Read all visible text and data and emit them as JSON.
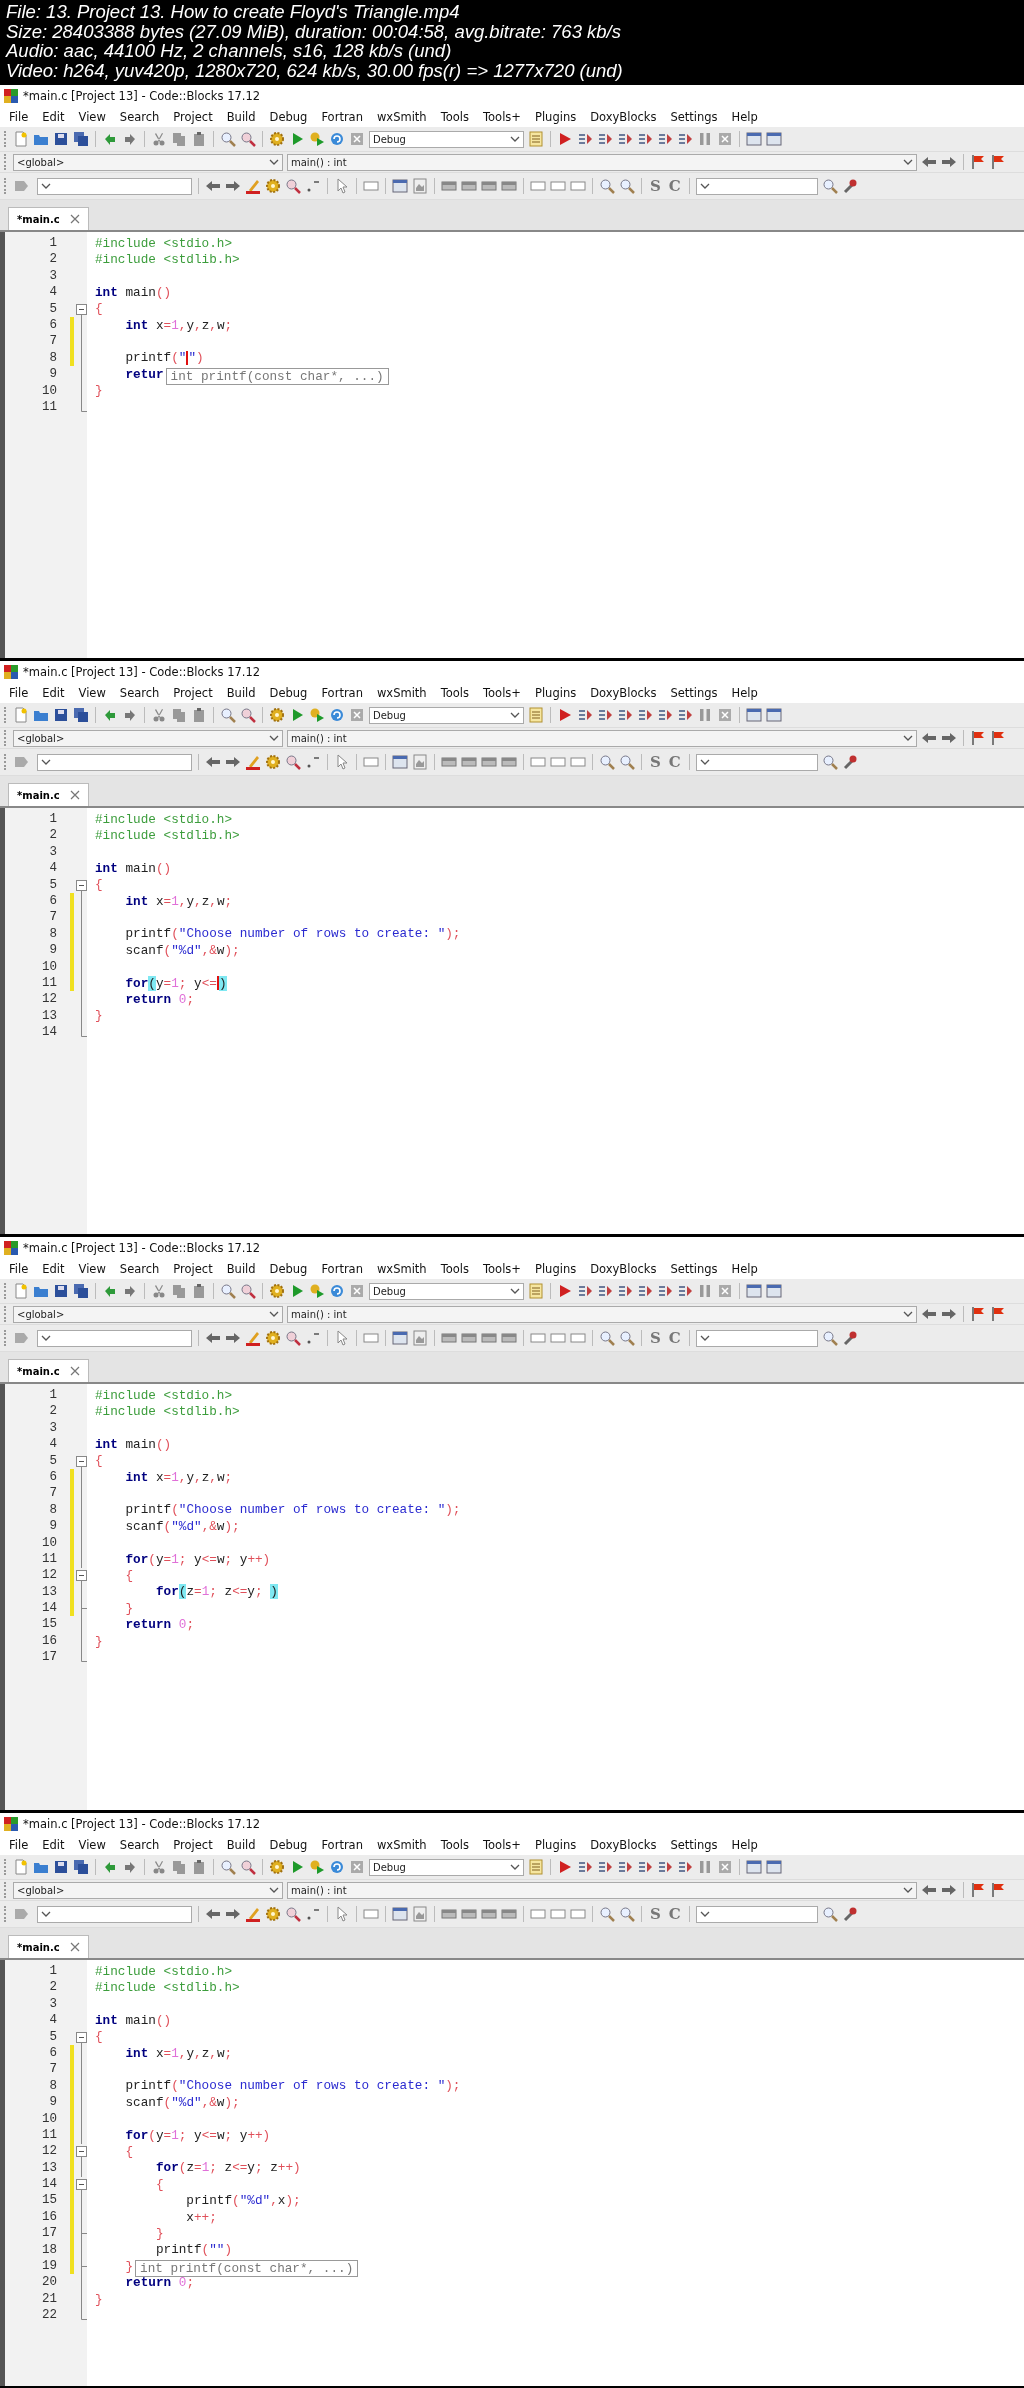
{
  "header": [
    "File: 13. Project 13. How to create Floyd's Triangle.mp4",
    "Size: 28403388 bytes (27.09 MiB), duration: 00:04:58, avg.bitrate: 763 kb/s",
    "Audio: aac, 44100 Hz, 2 channels, s16, 128 kb/s (und)",
    "Video: h264, yuv420p, 1280x720, 624 kb/s, 30.00 fps(r) => 1277x720 (und)"
  ],
  "frames": [
    {
      "window_title": "*main.c [Project 13] - Code::Blocks 17.12",
      "menu": [
        "File",
        "Edit",
        "View",
        "Search",
        "Project",
        "Build",
        "Debug",
        "Fortran",
        "wxSmith",
        "Tools",
        "Tools+",
        "Plugins",
        "DoxyBlocks",
        "Settings",
        "Help"
      ],
      "build_target": "Debug",
      "scope": "<global>",
      "function": "main() : int",
      "toolbar_letters": [
        "S",
        "C"
      ],
      "tab": {
        "label": "*main.c",
        "selected": true
      },
      "code": [
        {
          "number": "1",
          "changed": false,
          "kind": "plain",
          "tokens": [
            {
              "kind": "pp",
              "text": "#include <stdio.h>"
            }
          ]
        },
        {
          "number": "2",
          "changed": false,
          "kind": "plain",
          "tokens": [
            {
              "kind": "pp",
              "text": "#include <stdlib.h>"
            }
          ]
        },
        {
          "number": "3",
          "changed": false,
          "kind": "plain"
        },
        {
          "number": "4",
          "changed": false,
          "kind": "plain",
          "tokens": [
            {
              "kind": "kw",
              "text": "int"
            },
            {
              "kind": "txt",
              "text": " main"
            },
            {
              "kind": "op",
              "text": "()"
            }
          ]
        },
        {
          "number": "5",
          "changed": false,
          "kind": "fold_start",
          "tokens": [
            {
              "kind": "op",
              "text": "{"
            }
          ]
        },
        {
          "number": "6",
          "changed": true,
          "kind": "fold_body",
          "tokens": [
            {
              "kind": "kw",
              "text": "    int"
            },
            {
              "kind": "txt",
              "text": " x"
            },
            {
              "kind": "op",
              "text": "="
            },
            {
              "kind": "num",
              "text": "1"
            },
            {
              "kind": "op",
              "text": ","
            },
            {
              "kind": "txt",
              "text": "y"
            },
            {
              "kind": "op",
              "text": ","
            },
            {
              "kind": "txt",
              "text": "z"
            },
            {
              "kind": "op",
              "text": ","
            },
            {
              "kind": "txt",
              "text": "w"
            },
            {
              "kind": "op",
              "text": ";"
            }
          ]
        },
        {
          "number": "7",
          "changed": true,
          "kind": "fold_body"
        },
        {
          "number": "8",
          "changed": true,
          "kind": "fold_body",
          "tokens": [
            {
              "kind": "txt",
              "text": "    printf"
            },
            {
              "kind": "op",
              "text": "("
            },
            {
              "kind": "str",
              "text": "\""
            },
            {
              "kind": "caret"
            },
            {
              "kind": "str",
              "text": "\""
            },
            {
              "kind": "op",
              "text": ")"
            }
          ]
        },
        {
          "number": "9",
          "changed": false,
          "kind": "fold_body",
          "tokens": [
            {
              "kind": "kw",
              "text": "    retur"
            }
          ],
          "calltip": "int printf(const char*, ...)"
        },
        {
          "number": "10",
          "changed": false,
          "kind": "fold_body",
          "tokens": [
            {
              "kind": "op",
              "text": "}"
            }
          ]
        },
        {
          "number": "11",
          "changed": false,
          "kind": "fold_end"
        }
      ]
    },
    {
      "window_title": "*main.c [Project 13] - Code::Blocks 17.12",
      "menu": [
        "File",
        "Edit",
        "View",
        "Search",
        "Project",
        "Build",
        "Debug",
        "Fortran",
        "wxSmith",
        "Tools",
        "Tools+",
        "Plugins",
        "DoxyBlocks",
        "Settings",
        "Help"
      ],
      "build_target": "Debug",
      "scope": "<global>",
      "function": "main() : int",
      "toolbar_letters": [
        "S",
        "C"
      ],
      "tab": {
        "label": "*main.c",
        "selected": true
      },
      "code": [
        {
          "number": "1",
          "changed": false,
          "kind": "plain",
          "tokens": [
            {
              "kind": "pp",
              "text": "#include <stdio.h>"
            }
          ]
        },
        {
          "number": "2",
          "changed": false,
          "kind": "plain",
          "tokens": [
            {
              "kind": "pp",
              "text": "#include <stdlib.h>"
            }
          ]
        },
        {
          "number": "3",
          "changed": false,
          "kind": "plain"
        },
        {
          "number": "4",
          "changed": false,
          "kind": "plain",
          "tokens": [
            {
              "kind": "kw",
              "text": "int"
            },
            {
              "kind": "txt",
              "text": " main"
            },
            {
              "kind": "op",
              "text": "()"
            }
          ]
        },
        {
          "number": "5",
          "changed": false,
          "kind": "fold_start",
          "tokens": [
            {
              "kind": "op",
              "text": "{"
            }
          ]
        },
        {
          "number": "6",
          "changed": true,
          "kind": "fold_body",
          "tokens": [
            {
              "kind": "kw",
              "text": "    int"
            },
            {
              "kind": "txt",
              "text": " x"
            },
            {
              "kind": "op",
              "text": "="
            },
            {
              "kind": "num",
              "text": "1"
            },
            {
              "kind": "op",
              "text": ","
            },
            {
              "kind": "txt",
              "text": "y"
            },
            {
              "kind": "op",
              "text": ","
            },
            {
              "kind": "txt",
              "text": "z"
            },
            {
              "kind": "op",
              "text": ","
            },
            {
              "kind": "txt",
              "text": "w"
            },
            {
              "kind": "op",
              "text": ";"
            }
          ]
        },
        {
          "number": "7",
          "changed": true,
          "kind": "fold_body"
        },
        {
          "number": "8",
          "changed": true,
          "kind": "fold_body",
          "tokens": [
            {
              "kind": "txt",
              "text": "    printf"
            },
            {
              "kind": "op",
              "text": "("
            },
            {
              "kind": "str",
              "text": "\"Choose number of rows to create: \""
            },
            {
              "kind": "op",
              "text": ");"
            }
          ]
        },
        {
          "number": "9",
          "changed": true,
          "kind": "fold_body",
          "tokens": [
            {
              "kind": "txt",
              "text": "    scanf"
            },
            {
              "kind": "op",
              "text": "("
            },
            {
              "kind": "str",
              "text": "\"%d\""
            },
            {
              "kind": "op",
              "text": ",&"
            },
            {
              "kind": "txt",
              "text": "w"
            },
            {
              "kind": "op",
              "text": ");"
            }
          ]
        },
        {
          "number": "10",
          "changed": true,
          "kind": "fold_body"
        },
        {
          "number": "11",
          "changed": true,
          "kind": "fold_body",
          "tokens": [
            {
              "kind": "kw",
              "text": "    for"
            },
            {
              "kind": "match",
              "text": "("
            },
            {
              "kind": "txt",
              "text": "y"
            },
            {
              "kind": "op",
              "text": "="
            },
            {
              "kind": "num",
              "text": "1"
            },
            {
              "kind": "op",
              "text": ";"
            },
            {
              "kind": "txt",
              "text": " y"
            },
            {
              "kind": "op",
              "text": "<="
            },
            {
              "kind": "caret"
            },
            {
              "kind": "match",
              "text": ")"
            }
          ]
        },
        {
          "number": "12",
          "changed": false,
          "kind": "fold_body",
          "tokens": [
            {
              "kind": "kw",
              "text": "    return "
            },
            {
              "kind": "num",
              "text": "0"
            },
            {
              "kind": "op",
              "text": ";"
            }
          ]
        },
        {
          "number": "13",
          "changed": false,
          "kind": "fold_body",
          "tokens": [
            {
              "kind": "op",
              "text": "}"
            }
          ]
        },
        {
          "number": "14",
          "changed": false,
          "kind": "fold_end"
        }
      ]
    },
    {
      "window_title": "*main.c [Project 13] - Code::Blocks 17.12",
      "menu": [
        "File",
        "Edit",
        "View",
        "Search",
        "Project",
        "Build",
        "Debug",
        "Fortran",
        "wxSmith",
        "Tools",
        "Tools+",
        "Plugins",
        "DoxyBlocks",
        "Settings",
        "Help"
      ],
      "build_target": "Debug",
      "scope": "<global>",
      "function": "main() : int",
      "toolbar_letters": [
        "S",
        "C"
      ],
      "tab": {
        "label": "*main.c",
        "selected": true
      },
      "code": [
        {
          "number": "1",
          "changed": false,
          "kind": "plain",
          "tokens": [
            {
              "kind": "pp",
              "text": "#include <stdio.h>"
            }
          ]
        },
        {
          "number": "2",
          "changed": false,
          "kind": "plain",
          "tokens": [
            {
              "kind": "pp",
              "text": "#include <stdlib.h>"
            }
          ]
        },
        {
          "number": "3",
          "changed": false,
          "kind": "plain"
        },
        {
          "number": "4",
          "changed": false,
          "kind": "plain",
          "tokens": [
            {
              "kind": "kw",
              "text": "int"
            },
            {
              "kind": "txt",
              "text": " main"
            },
            {
              "kind": "op",
              "text": "()"
            }
          ]
        },
        {
          "number": "5",
          "changed": false,
          "kind": "fold_start",
          "tokens": [
            {
              "kind": "op",
              "text": "{"
            }
          ]
        },
        {
          "number": "6",
          "changed": true,
          "kind": "fold_body",
          "tokens": [
            {
              "kind": "kw",
              "text": "    int"
            },
            {
              "kind": "txt",
              "text": " x"
            },
            {
              "kind": "op",
              "text": "="
            },
            {
              "kind": "num",
              "text": "1"
            },
            {
              "kind": "op",
              "text": ","
            },
            {
              "kind": "txt",
              "text": "y"
            },
            {
              "kind": "op",
              "text": ","
            },
            {
              "kind": "txt",
              "text": "z"
            },
            {
              "kind": "op",
              "text": ","
            },
            {
              "kind": "txt",
              "text": "w"
            },
            {
              "kind": "op",
              "text": ";"
            }
          ]
        },
        {
          "number": "7",
          "changed": true,
          "kind": "fold_body"
        },
        {
          "number": "8",
          "changed": true,
          "kind": "fold_body",
          "tokens": [
            {
              "kind": "txt",
              "text": "    printf"
            },
            {
              "kind": "op",
              "text": "("
            },
            {
              "kind": "str",
              "text": "\"Choose number of rows to create: \""
            },
            {
              "kind": "op",
              "text": ");"
            }
          ]
        },
        {
          "number": "9",
          "changed": true,
          "kind": "fold_body",
          "tokens": [
            {
              "kind": "txt",
              "text": "    scanf"
            },
            {
              "kind": "op",
              "text": "("
            },
            {
              "kind": "str",
              "text": "\"%d\""
            },
            {
              "kind": "op",
              "text": ",&"
            },
            {
              "kind": "txt",
              "text": "w"
            },
            {
              "kind": "op",
              "text": ");"
            }
          ]
        },
        {
          "number": "10",
          "changed": true,
          "kind": "fold_body"
        },
        {
          "number": "11",
          "changed": true,
          "kind": "fold_body",
          "tokens": [
            {
              "kind": "kw",
              "text": "    for"
            },
            {
              "kind": "op",
              "text": "("
            },
            {
              "kind": "txt",
              "text": "y"
            },
            {
              "kind": "op",
              "text": "="
            },
            {
              "kind": "num",
              "text": "1"
            },
            {
              "kind": "op",
              "text": ";"
            },
            {
              "kind": "txt",
              "text": " y"
            },
            {
              "kind": "op",
              "text": "<="
            },
            {
              "kind": "txt",
              "text": "w"
            },
            {
              "kind": "op",
              "text": ";"
            },
            {
              "kind": "txt",
              "text": " y"
            },
            {
              "kind": "op",
              "text": "++)"
            }
          ]
        },
        {
          "number": "12",
          "changed": true,
          "kind": "fold_start",
          "tokens": [
            {
              "kind": "op",
              "text": "    {"
            }
          ]
        },
        {
          "number": "13",
          "changed": true,
          "kind": "fold_body",
          "tokens": [
            {
              "kind": "kw",
              "text": "        for"
            },
            {
              "kind": "match",
              "text": "("
            },
            {
              "kind": "txt",
              "text": "z"
            },
            {
              "kind": "op",
              "text": "="
            },
            {
              "kind": "num",
              "text": "1"
            },
            {
              "kind": "op",
              "text": ";"
            },
            {
              "kind": "txt",
              "text": " z"
            },
            {
              "kind": "op",
              "text": "<="
            },
            {
              "kind": "txt",
              "text": "y"
            },
            {
              "kind": "op",
              "text": "; "
            },
            {
              "kind": "match",
              "text": ")"
            }
          ]
        },
        {
          "number": "14",
          "changed": true,
          "kind": "fold_tick",
          "tokens": [
            {
              "kind": "op",
              "text": "    }"
            }
          ]
        },
        {
          "number": "15",
          "changed": false,
          "kind": "fold_body",
          "tokens": [
            {
              "kind": "kw",
              "text": "    return "
            },
            {
              "kind": "num",
              "text": "0"
            },
            {
              "kind": "op",
              "text": ";"
            }
          ]
        },
        {
          "number": "16",
          "changed": false,
          "kind": "fold_body",
          "tokens": [
            {
              "kind": "op",
              "text": "}"
            }
          ]
        },
        {
          "number": "17",
          "changed": false,
          "kind": "fold_end"
        }
      ]
    },
    {
      "window_title": "*main.c [Project 13] - Code::Blocks 17.12",
      "menu": [
        "File",
        "Edit",
        "View",
        "Search",
        "Project",
        "Build",
        "Debug",
        "Fortran",
        "wxSmith",
        "Tools",
        "Tools+",
        "Plugins",
        "DoxyBlocks",
        "Settings",
        "Help"
      ],
      "build_target": "Debug",
      "scope": "<global>",
      "function": "main() : int",
      "toolbar_letters": [
        "S",
        "C"
      ],
      "tab": {
        "label": "*main.c",
        "selected": true
      },
      "code": [
        {
          "number": "1",
          "changed": false,
          "kind": "plain",
          "tokens": [
            {
              "kind": "pp",
              "text": "#include <stdio.h>"
            }
          ]
        },
        {
          "number": "2",
          "changed": false,
          "kind": "plain",
          "tokens": [
            {
              "kind": "pp",
              "text": "#include <stdlib.h>"
            }
          ]
        },
        {
          "number": "3",
          "changed": false,
          "kind": "plain"
        },
        {
          "number": "4",
          "changed": false,
          "kind": "plain",
          "tokens": [
            {
              "kind": "kw",
              "text": "int"
            },
            {
              "kind": "txt",
              "text": " main"
            },
            {
              "kind": "op",
              "text": "()"
            }
          ]
        },
        {
          "number": "5",
          "changed": false,
          "kind": "fold_start",
          "tokens": [
            {
              "kind": "op",
              "text": "{"
            }
          ]
        },
        {
          "number": "6",
          "changed": true,
          "kind": "fold_body",
          "tokens": [
            {
              "kind": "kw",
              "text": "    int"
            },
            {
              "kind": "txt",
              "text": " x"
            },
            {
              "kind": "op",
              "text": "="
            },
            {
              "kind": "num",
              "text": "1"
            },
            {
              "kind": "op",
              "text": ","
            },
            {
              "kind": "txt",
              "text": "y"
            },
            {
              "kind": "op",
              "text": ","
            },
            {
              "kind": "txt",
              "text": "z"
            },
            {
              "kind": "op",
              "text": ","
            },
            {
              "kind": "txt",
              "text": "w"
            },
            {
              "kind": "op",
              "text": ";"
            }
          ]
        },
        {
          "number": "7",
          "changed": true,
          "kind": "fold_body"
        },
        {
          "number": "8",
          "changed": true,
          "kind": "fold_body",
          "tokens": [
            {
              "kind": "txt",
              "text": "    printf"
            },
            {
              "kind": "op",
              "text": "("
            },
            {
              "kind": "str",
              "text": "\"Choose number of rows to create: \""
            },
            {
              "kind": "op",
              "text": ");"
            }
          ]
        },
        {
          "number": "9",
          "changed": true,
          "kind": "fold_body",
          "tokens": [
            {
              "kind": "txt",
              "text": "    scanf"
            },
            {
              "kind": "op",
              "text": "("
            },
            {
              "kind": "str",
              "text": "\"%d\""
            },
            {
              "kind": "op",
              "text": ",&"
            },
            {
              "kind": "txt",
              "text": "w"
            },
            {
              "kind": "op",
              "text": ");"
            }
          ]
        },
        {
          "number": "10",
          "changed": true,
          "kind": "fold_body"
        },
        {
          "number": "11",
          "changed": true,
          "kind": "fold_body",
          "tokens": [
            {
              "kind": "kw",
              "text": "    for"
            },
            {
              "kind": "op",
              "text": "("
            },
            {
              "kind": "txt",
              "text": "y"
            },
            {
              "kind": "op",
              "text": "="
            },
            {
              "kind": "num",
              "text": "1"
            },
            {
              "kind": "op",
              "text": ";"
            },
            {
              "kind": "txt",
              "text": " y"
            },
            {
              "kind": "op",
              "text": "<="
            },
            {
              "kind": "txt",
              "text": "w"
            },
            {
              "kind": "op",
              "text": ";"
            },
            {
              "kind": "txt",
              "text": " y"
            },
            {
              "kind": "op",
              "text": "++)"
            }
          ]
        },
        {
          "number": "12",
          "changed": true,
          "kind": "fold_start",
          "tokens": [
            {
              "kind": "op",
              "text": "    {"
            }
          ]
        },
        {
          "number": "13",
          "changed": true,
          "kind": "fold_body",
          "tokens": [
            {
              "kind": "kw",
              "text": "        for"
            },
            {
              "kind": "op",
              "text": "("
            },
            {
              "kind": "txt",
              "text": "z"
            },
            {
              "kind": "op",
              "text": "="
            },
            {
              "kind": "num",
              "text": "1"
            },
            {
              "kind": "op",
              "text": ";"
            },
            {
              "kind": "txt",
              "text": " z"
            },
            {
              "kind": "op",
              "text": "<="
            },
            {
              "kind": "txt",
              "text": "y"
            },
            {
              "kind": "op",
              "text": ";"
            },
            {
              "kind": "txt",
              "text": " z"
            },
            {
              "kind": "op",
              "text": "++)"
            }
          ]
        },
        {
          "number": "14",
          "changed": true,
          "kind": "fold_start",
          "tokens": [
            {
              "kind": "op",
              "text": "        {"
            }
          ]
        },
        {
          "number": "15",
          "changed": true,
          "kind": "fold_body",
          "tokens": [
            {
              "kind": "txt",
              "text": "            printf"
            },
            {
              "kind": "op",
              "text": "("
            },
            {
              "kind": "str",
              "text": "\"%d\""
            },
            {
              "kind": "op",
              "text": ","
            },
            {
              "kind": "txt",
              "text": "x"
            },
            {
              "kind": "op",
              "text": ");"
            }
          ]
        },
        {
          "number": "16",
          "changed": true,
          "kind": "fold_body",
          "tokens": [
            {
              "kind": "txt",
              "text": "            x"
            },
            {
              "kind": "op",
              "text": "++;"
            }
          ]
        },
        {
          "number": "17",
          "changed": true,
          "kind": "fold_tick",
          "tokens": [
            {
              "kind": "op",
              "text": "        }"
            }
          ]
        },
        {
          "number": "18",
          "changed": true,
          "kind": "fold_body",
          "tokens": [
            {
              "kind": "txt",
              "text": "        printf"
            },
            {
              "kind": "op",
              "text": "("
            },
            {
              "kind": "str",
              "text": "\"\""
            },
            {
              "kind": "op",
              "text": ")"
            }
          ]
        },
        {
          "number": "19",
          "changed": true,
          "kind": "fold_tick",
          "tokens": [
            {
              "kind": "op",
              "text": "    }"
            }
          ],
          "calltip": "int printf(const char*, ...)"
        },
        {
          "number": "20",
          "changed": false,
          "kind": "fold_body",
          "tokens": [
            {
              "kind": "kw",
              "text": "    return "
            },
            {
              "kind": "num",
              "text": "0"
            },
            {
              "kind": "op",
              "text": ";"
            }
          ]
        },
        {
          "number": "21",
          "changed": false,
          "kind": "fold_body",
          "tokens": [
            {
              "kind": "op",
              "text": "}"
            }
          ]
        },
        {
          "number": "22",
          "changed": false,
          "kind": "fold_end"
        }
      ]
    }
  ]
}
